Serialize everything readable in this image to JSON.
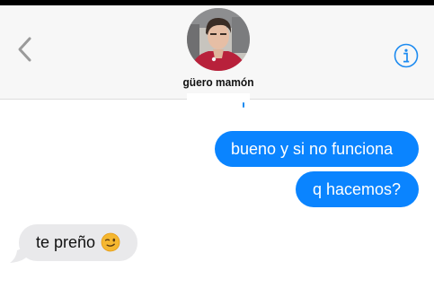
{
  "header": {
    "contact_name": "güero mamón",
    "back_icon": "chevron-left-icon",
    "info_icon": "info-circle-icon",
    "accent_color": "#1d8bf0"
  },
  "messages": [
    {
      "direction": "outgoing",
      "text": "bueno y si no funciona",
      "color": "#0a84ff"
    },
    {
      "direction": "outgoing",
      "text": "q hacemos?",
      "color": "#0a84ff"
    },
    {
      "direction": "incoming",
      "text": "te preño",
      "emoji": "winking-face-emoji",
      "color": "#e9e9eb"
    }
  ]
}
